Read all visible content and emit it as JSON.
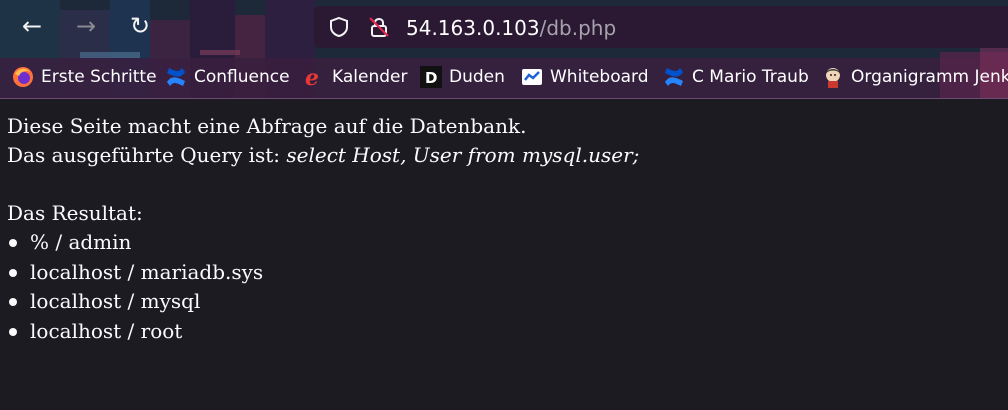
{
  "browser": {
    "url_host": "54.163.0.103",
    "url_path": "/db.php",
    "back_label": "←",
    "forward_label": "→",
    "reload_label": "↻",
    "bookmarks": [
      {
        "label": "Erste Schritte",
        "icon": "firefox-icon"
      },
      {
        "label": "Confluence",
        "icon": "confluence-icon"
      },
      {
        "label": "Kalender",
        "icon": "kalender-icon"
      },
      {
        "label": "Duden",
        "icon": "duden-icon"
      },
      {
        "label": "Whiteboard",
        "icon": "whiteboard-icon"
      },
      {
        "label": "C Mario Traub",
        "icon": "confluence-icon"
      },
      {
        "label": "Organigramm Jenki",
        "icon": "jenkins-icon"
      }
    ]
  },
  "page": {
    "line1": "Diese Seite macht eine Abfrage auf die Datenbank.",
    "query_prefix": "Das ausgeführte Query ist: ",
    "query": "select Host, User from mysql.user;",
    "result_label": "Das Resultat:",
    "results": [
      "% / admin",
      "localhost / mariadb.sys",
      "localhost / mysql",
      "localhost / root"
    ]
  },
  "colors": {
    "page_bg": "#1c1b22",
    "text": "#fbfbfe",
    "urlbar_bg": "#2b1833"
  }
}
